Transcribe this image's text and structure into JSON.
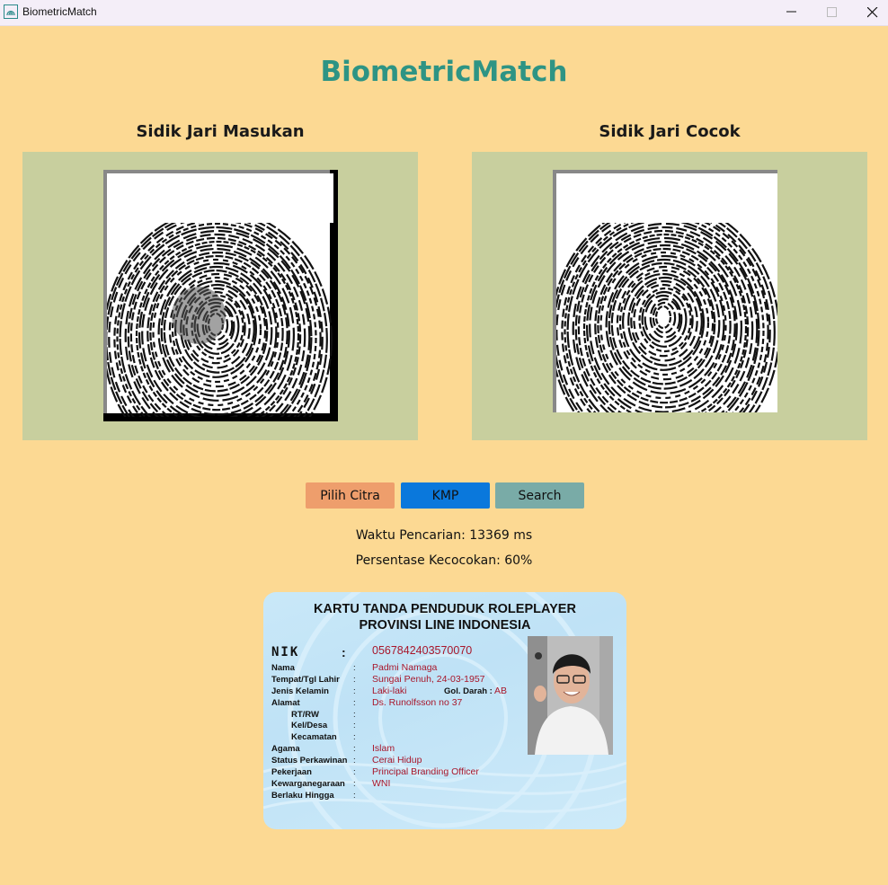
{
  "window": {
    "title": "BiometricMatch"
  },
  "app": {
    "title": "BiometricMatch"
  },
  "panels": {
    "input_label": "Sidik Jari Masukan",
    "match_label": "Sidik Jari Cocok"
  },
  "buttons": {
    "pilih": "Pilih Citra",
    "kmp": "KMP",
    "search": "Search"
  },
  "stats": {
    "time": "Waktu Pencarian: 13369 ms",
    "percentage": "Persentase Kecocokan: 60%"
  },
  "ktp": {
    "header1": "KARTU TANDA PENDUDUK ROLEPLAYER",
    "header2": "PROVINSI LINE INDONESIA",
    "nik_label": "NIK",
    "nik_colon": ":",
    "nik": "0567842403570070",
    "colon": ":",
    "labels": {
      "nama": "Nama",
      "ttl": "Tempat/Tgl Lahir",
      "jk": "Jenis Kelamin",
      "alamat": "Alamat",
      "rtrw": "RT/RW",
      "keldesa": "Kel/Desa",
      "kecamatan": "Kecamatan",
      "agama": "Agama",
      "status": "Status Perkawinan",
      "pekerjaan": "Pekerjaan",
      "kewarganegaraan": "Kewarganegaraan",
      "berlaku": "Berlaku Hingga",
      "gol": "Gol. Darah :"
    },
    "values": {
      "nama": "Padmi Namaga",
      "ttl": "Sungai Penuh, 24-03-1957",
      "jk": "Laki-laki",
      "gol": "AB",
      "alamat": "Ds. Runolfsson no 37",
      "agama": "Islam",
      "status": "Cerai Hidup",
      "pekerjaan": "Principal Branding Officer",
      "kewarganegaraan": "WNI"
    }
  },
  "colors": {
    "background": "#fcd993",
    "accent": "#2e9484",
    "panel": "#c8cf9e"
  },
  "icons": {
    "app": "fingerprint-icon",
    "minimize": "minimize-icon",
    "maximize": "maximize-icon",
    "close": "close-icon"
  }
}
